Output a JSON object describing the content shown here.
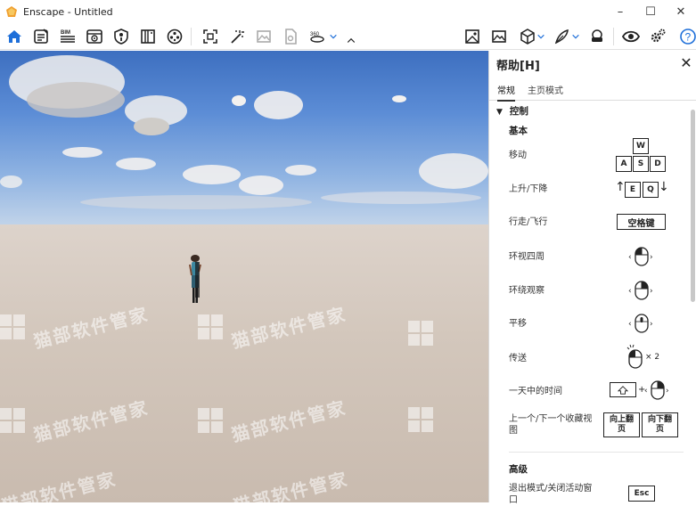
{
  "window": {
    "title": "Enscape - Untitled",
    "minimize": "–",
    "maximize": "☐",
    "close": "✕"
  },
  "toolbar": {
    "bim_label": "BIM",
    "icons": [
      "home-icon",
      "notes-icon",
      "bim-icon",
      "view-icon",
      "info-icon",
      "books-icon",
      "video-icon",
      "screenshot-icon",
      "magic-icon",
      "image-icon",
      "file-icon",
      "panorama-icon",
      "settings-icon",
      "asset-library-icon",
      "cube-icon",
      "feather-icon",
      "vr-icon",
      "eye-icon",
      "gear-icon",
      "help-icon"
    ]
  },
  "panel": {
    "title": "帮助[H]",
    "tabs": [
      "常规",
      "主页模式"
    ],
    "section": "控制",
    "basic_title": "基本",
    "rows": [
      {
        "label": "移动"
      },
      {
        "label": "上升/下降"
      },
      {
        "label": "行走/飞行"
      },
      {
        "label": "环视四周"
      },
      {
        "label": "环绕观察"
      },
      {
        "label": "平移"
      },
      {
        "label": "传送"
      },
      {
        "label": "一天中的时间"
      },
      {
        "label": "上一个/下一个收藏视图"
      }
    ],
    "keys": {
      "w": "W",
      "a": "A",
      "s": "S",
      "d": "D",
      "e": "E",
      "q": "Q",
      "space": "空格键",
      "page_up": "向上翻页",
      "page_down": "向下翻页",
      "esc": "Esc",
      "times_two": "× 2",
      "plus": "+",
      "up_arrow": "↑",
      "down_arrow": "↓"
    },
    "advanced_title": "高级",
    "advanced_row": "退出模式/关闭活动窗口"
  },
  "viewport": {
    "watermark": "猫部软件管家"
  }
}
